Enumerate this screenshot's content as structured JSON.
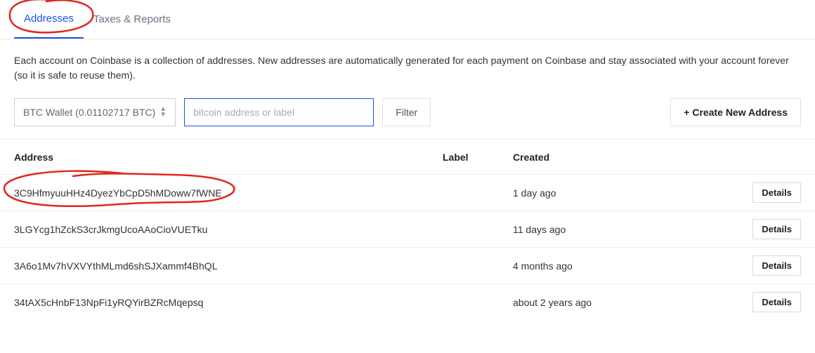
{
  "tabs": [
    {
      "label": "Addresses",
      "active": true
    },
    {
      "label": "Taxes & Reports",
      "active": false
    }
  ],
  "description": "Each account on Coinbase is a collection of addresses. New addresses are automatically generated for each payment on Coinbase and stay associated with your account forever (so it is safe to reuse them).",
  "controls": {
    "wallet_select": "BTC Wallet (0.01102717 BTC)",
    "search_placeholder": "bitcoin address or label",
    "filter_label": "Filter",
    "create_label": "+ Create New Address"
  },
  "table": {
    "headers": {
      "address": "Address",
      "label": "Label",
      "created": "Created"
    },
    "rows": [
      {
        "address": "3C9HfmyuuHHz4DyezYbCpD5hMDoww7fWNE",
        "label": "",
        "created": "1 day ago",
        "action": "Details"
      },
      {
        "address": "3LGYcg1hZckS3crJkmgUcoAAoCioVUETku",
        "label": "",
        "created": "11 days ago",
        "action": "Details"
      },
      {
        "address": "3A6o1Mv7hVXVYthMLmd6shSJXammf4BhQL",
        "label": "",
        "created": "4 months ago",
        "action": "Details"
      },
      {
        "address": "34tAX5cHnbF13NpFi1yRQYirBZRcMqepsq",
        "label": "",
        "created": "about 2 years ago",
        "action": "Details"
      }
    ]
  }
}
